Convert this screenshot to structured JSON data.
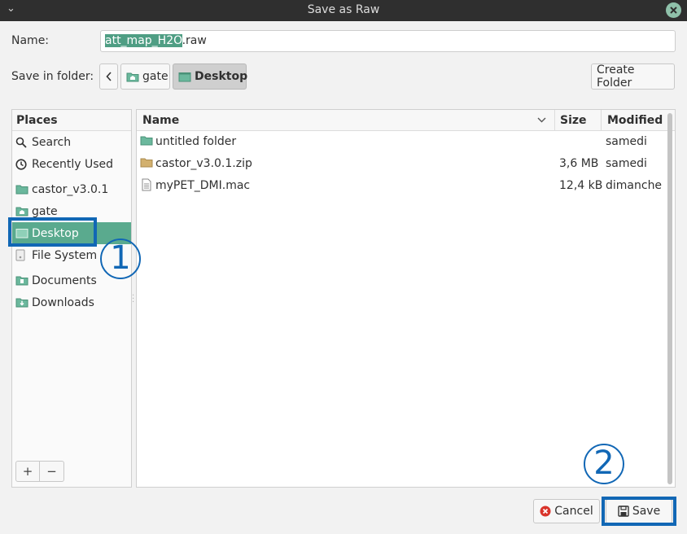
{
  "window": {
    "title": "Save as Raw"
  },
  "name_row": {
    "label": "Name:",
    "selected_part": "att_map_H2O",
    "rest": ".raw"
  },
  "folder_row": {
    "label": "Save in folder:",
    "crumbs": [
      {
        "label": "gate",
        "icon": "home-folder-icon"
      },
      {
        "label": "Desktop",
        "icon": "desktop-folder-icon"
      }
    ],
    "create_folder_label": "Create Folder"
  },
  "places": {
    "header": "Places",
    "items": [
      {
        "label": "Search",
        "icon": "search-icon"
      },
      {
        "label": "Recently Used",
        "icon": "clock-icon"
      },
      {
        "label": "castor_v3.0.1",
        "icon": "folder-icon"
      },
      {
        "label": "gate",
        "icon": "home-folder-icon"
      },
      {
        "label": "Desktop",
        "icon": "desktop-folder-icon",
        "selected": true
      },
      {
        "label": "File System",
        "icon": "drive-icon"
      },
      {
        "label": "Documents",
        "icon": "documents-folder-icon"
      },
      {
        "label": "Downloads",
        "icon": "downloads-folder-icon"
      }
    ],
    "add_label": "+",
    "remove_label": "−"
  },
  "files": {
    "columns": {
      "name": "Name",
      "size": "Size",
      "modified": "Modified"
    },
    "rows": [
      {
        "name": "untitled folder",
        "size": "",
        "modified": "samedi",
        "icon": "folder-icon"
      },
      {
        "name": "castor_v3.0.1.zip",
        "size": "3,6 MB",
        "modified": "samedi",
        "icon": "archive-icon"
      },
      {
        "name": "myPET_DMI.mac",
        "size": "12,4 kB",
        "modified": "dimanche",
        "icon": "text-file-icon"
      }
    ]
  },
  "buttons": {
    "cancel": "Cancel",
    "save": "Save"
  },
  "annotations": {
    "one": "1",
    "two": "2"
  },
  "colors": {
    "accent": "#5aaa8e",
    "annotation": "#1167b5",
    "titlebar": "#2f2f2f"
  }
}
